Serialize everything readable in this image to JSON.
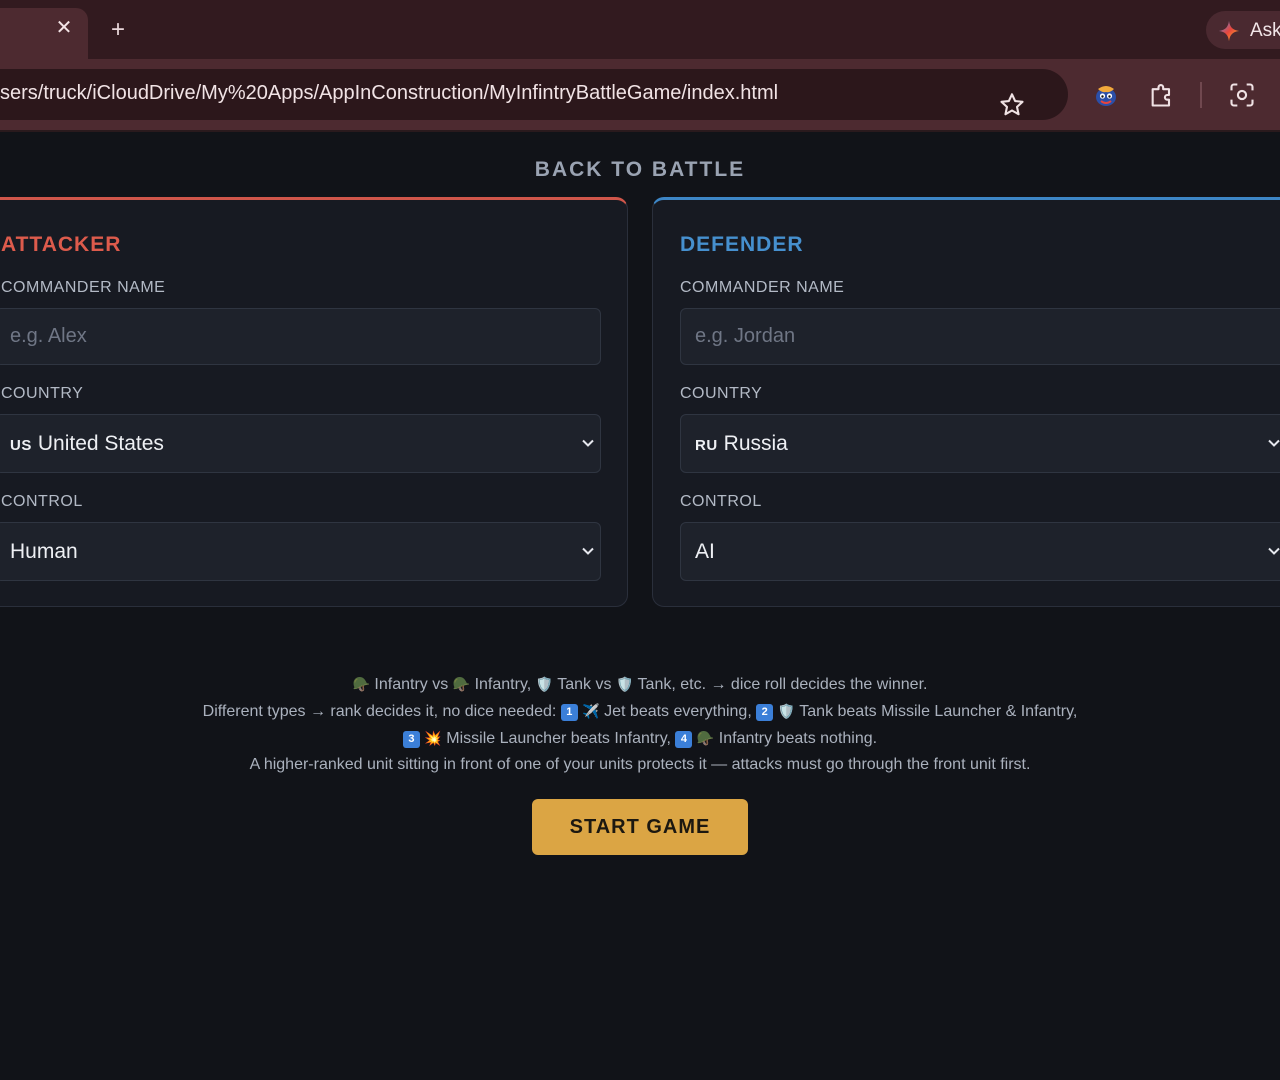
{
  "browser": {
    "tab_close": "✕",
    "new_tab": "+",
    "ask_label": "Ask",
    "url": "sers/truck/iCloudDrive/My%20Apps/AppInConstruction/MyInfintryBattleGame/index.html"
  },
  "page": {
    "back_link": "BACK TO BATTLE",
    "attacker": {
      "title": "ATTACKER",
      "name_label": "COMMANDER NAME",
      "name_placeholder": "e.g. Alex",
      "country_label": "COUNTRY",
      "country_flag": "US",
      "country_value": "United States",
      "control_label": "CONTROL",
      "control_value": "Human"
    },
    "defender": {
      "title": "DEFENDER",
      "name_label": "COMMANDER NAME",
      "name_placeholder": "e.g. Jordan",
      "country_label": "COUNTRY",
      "country_flag": "RU",
      "country_value": "Russia",
      "control_label": "CONTROL",
      "control_value": "AI"
    },
    "rules": {
      "line1": {
        "e1": "🪖",
        "t1": "Infantry vs",
        "e2": "🪖",
        "t2": "Infantry,",
        "e3": "🛡️",
        "t3": "Tank vs",
        "e4": "🛡️",
        "t4": "Tank, etc. → dice roll decides the winner."
      },
      "line2": {
        "t1": "Different types → rank decides it, no dice needed:",
        "n1": "1",
        "e1": "✈️",
        "t2": "Jet beats everything,",
        "n2": "2",
        "e2": "🛡️",
        "t3": "Tank beats Missile Launcher &",
        "t4": "Infantry,",
        "n3": "3",
        "e3": "💥",
        "t5": "Missile Launcher beats Infantry,",
        "n4": "4",
        "e4": "🪖",
        "t6": "Infantry beats nothing."
      },
      "line3": "A higher-ranked unit sitting in front of one of your units protects it — attacks must go through the front unit first."
    },
    "start_button": "START GAME"
  },
  "colors": {
    "attacker_accent": "#dd5b4c",
    "defender_accent": "#4690cf",
    "start_button": "#dba544",
    "background": "#111318",
    "browser_frame": "#4d2a30"
  }
}
